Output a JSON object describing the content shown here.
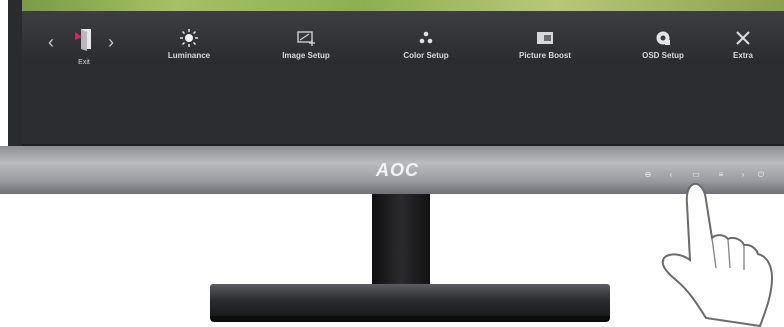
{
  "osd": {
    "exit_label": "Exit",
    "items": [
      {
        "label": "Luminance",
        "icon": "sun-icon"
      },
      {
        "label": "Image Setup",
        "icon": "image-setup-icon"
      },
      {
        "label": "Color Setup",
        "icon": "color-setup-icon"
      },
      {
        "label": "Picture Boost",
        "icon": "picture-boost-icon"
      },
      {
        "label": "OSD Setup",
        "icon": "osd-setup-icon"
      },
      {
        "label": "Extra",
        "icon": "extra-icon"
      }
    ]
  },
  "monitor": {
    "brand_logo": "AOC"
  },
  "colors": {
    "osd_background": "#2a2b2f",
    "bezel": "#9c9ea3",
    "stand": "#151618",
    "exit_icon": "#d6255f"
  }
}
